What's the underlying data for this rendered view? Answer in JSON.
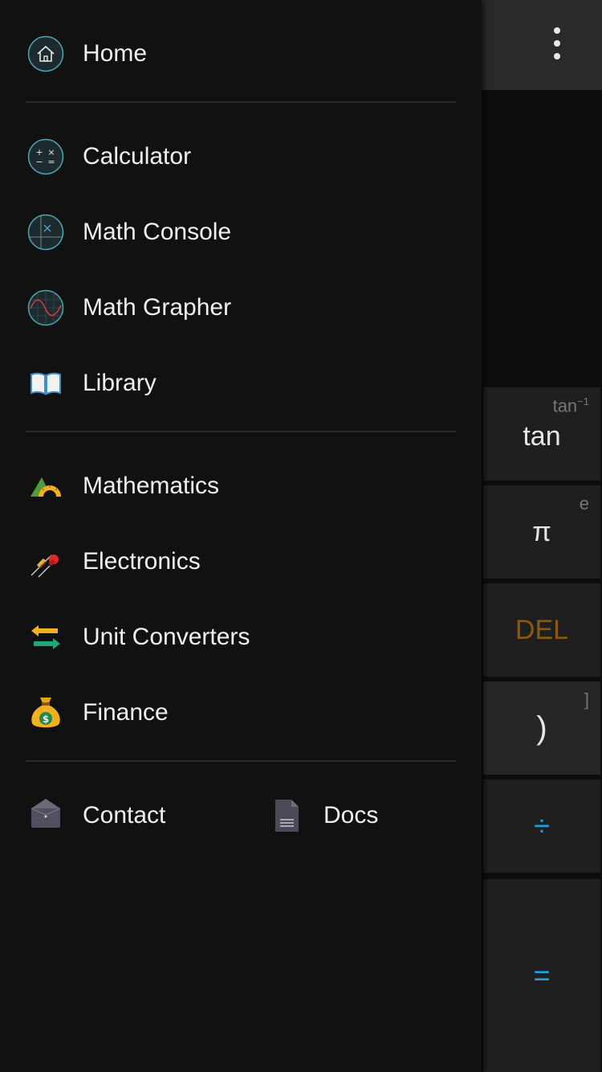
{
  "drawer": {
    "items": [
      {
        "label": "Home",
        "icon": "home-icon"
      },
      {
        "label": "Calculator",
        "icon": "calculator-icon"
      },
      {
        "label": "Math Console",
        "icon": "math-console-icon"
      },
      {
        "label": "Math Grapher",
        "icon": "math-grapher-icon"
      },
      {
        "label": "Library",
        "icon": "book-icon"
      },
      {
        "label": "Mathematics",
        "icon": "protractor-icon"
      },
      {
        "label": "Electronics",
        "icon": "resistor-led-icon"
      },
      {
        "label": "Unit Converters",
        "icon": "swap-arrows-icon"
      },
      {
        "label": "Finance",
        "icon": "money-bag-icon"
      }
    ],
    "footer": {
      "contact_label": "Contact",
      "docs_label": "Docs"
    }
  },
  "calculator": {
    "keys": [
      {
        "label": "tan",
        "secondary": "tan",
        "secondary_sup": "−1"
      },
      {
        "label": "π",
        "secondary": "e"
      },
      {
        "label": "DEL"
      },
      {
        "label": ")",
        "secondary": "]"
      },
      {
        "label": "÷"
      },
      {
        "label": "="
      }
    ]
  },
  "colors": {
    "drawer_bg": "#111111",
    "accent_blue": "#1aa3e0",
    "del_orange": "#8a5a12"
  }
}
